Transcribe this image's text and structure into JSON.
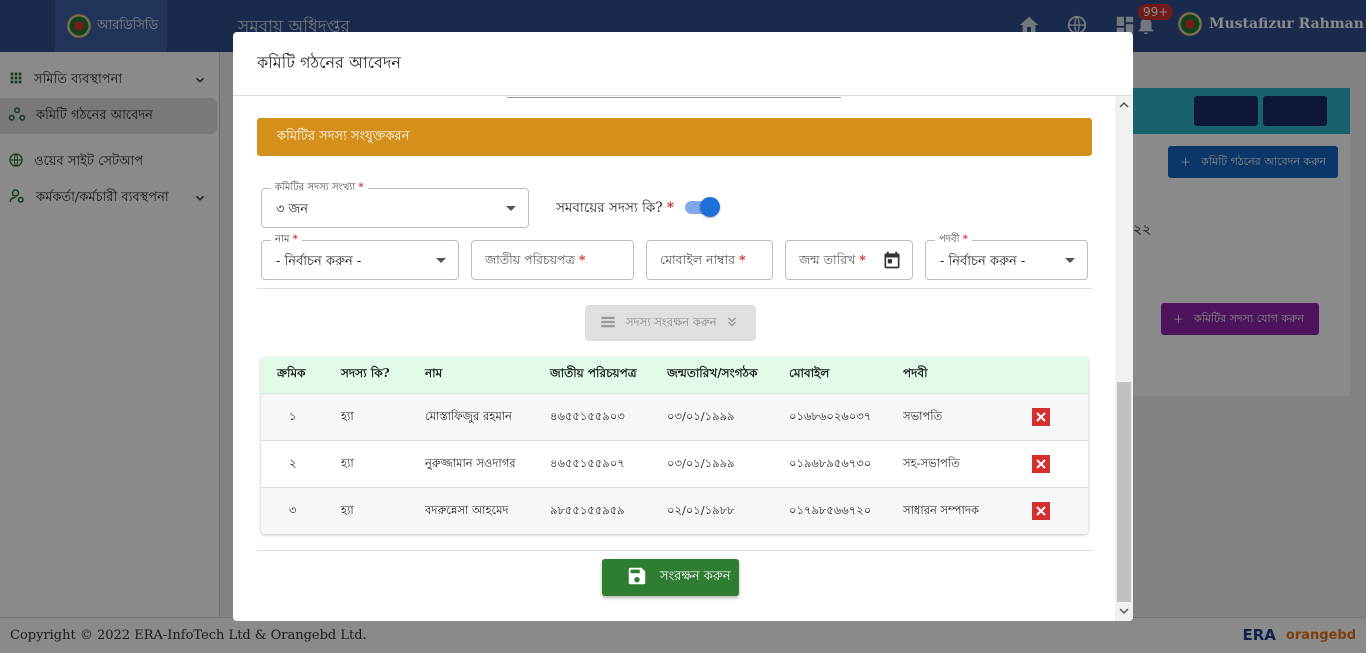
{
  "topbar": {
    "brand_label": "আরডিসিডি",
    "app_title": "সমবায় অধিদপ্তর",
    "notification_count": "99+",
    "user_name": "Mustafizur Rahman"
  },
  "sidebar": {
    "items": [
      {
        "label": "সমিতি ব্যবস্থাপনা"
      },
      {
        "label": "কমিটি গঠনের আবেদন"
      },
      {
        "label": "ওয়েব সাইট সেটআপ"
      },
      {
        "label": "কর্মকর্তা/কর্মচারী ব্যবস্থপনা"
      }
    ]
  },
  "background": {
    "apply_button": "কমিটি গঠনের আবেদন করুন",
    "add_member_button": "কমিটির সদস্য যোগ করুন",
    "partial_text": "২২"
  },
  "modal": {
    "title": "কমিটি গঠনের আবেদন",
    "section_title": "কমিটির সদস্য সংযুক্তকরন",
    "member_count": {
      "label": "কমিটির সদস্য সংখ্যা",
      "value": "৩ জন"
    },
    "is_member_label": "সমবায়ের সদস্য কি?",
    "is_member_value": true,
    "name_field": {
      "label": "নাম",
      "value": "- নির্বাচন করুন -"
    },
    "nid_field": {
      "placeholder": "জাতীয় পরিচয়পত্র"
    },
    "mobile_field": {
      "placeholder": "মোবাইল নাম্বার"
    },
    "dob_field": {
      "placeholder": "জন্ম তারিখ"
    },
    "position_field": {
      "label": "পদবী",
      "value": "- নির্বাচন করুন -"
    },
    "save_member_button": "সদস্য সংরক্ষন করুন",
    "table": {
      "headers": [
        "ক্রমিক",
        "সদস্য কি?",
        "নাম",
        "জাতীয় পরিচয়পত্র",
        "জন্মতারিখ/সংগঠক",
        "মোবাইল",
        "পদবী",
        ""
      ],
      "rows": [
        [
          "১",
          "হ্যা",
          "মোস্তাফিজুর রহমান",
          "৪৬৫৫১৫৫৯০৩",
          "০৩/০১/১৯৯৯",
          "০১৬৮৬০২৬০৩৭",
          "সভাপতি"
        ],
        [
          "২",
          "হ্যা",
          "নুরুজ্জামান সওদাগর",
          "৪৬৫৫১৫৫৯০৭",
          "০৩/০১/১৯৯৯",
          "০১৯৬৮৯৫৬৭৩০",
          "সহ-সভাপতি"
        ],
        [
          "৩",
          "হ্যা",
          "বদরুন্নেসা আহমেদ",
          "৯৮৫৫১৫৫৯৫৯",
          "০২/০১/১৯৮৮",
          "০১৭৯৮৫৬৬৭২০",
          "সাধারন সম্পাদক"
        ]
      ]
    },
    "final_save_button": "সংরক্ষন করুন"
  },
  "footer": {
    "copyright": "Copyright © 2022 ERA-InfoTech Ltd & Orangebd Ltd.",
    "logo_era": "ERA",
    "logo_orange": "orangebd"
  },
  "colors": {
    "section_bar": "#d4901a",
    "table_header": "#e2fbe8",
    "save_button": "#2e7d32",
    "delete": "#d32f2f",
    "toggle": "#1e6fd9"
  }
}
